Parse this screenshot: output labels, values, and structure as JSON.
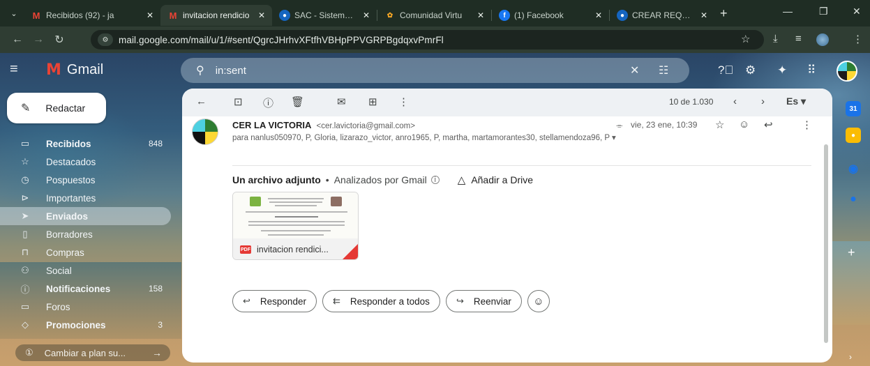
{
  "browser": {
    "tabs": [
      {
        "label": "Recibidos (92) - ja",
        "favicon": "gmail-icon",
        "active": false
      },
      {
        "label": "invitacion rendicio",
        "favicon": "gmail-icon",
        "active": true
      },
      {
        "label": "SAC - Sistema de",
        "favicon": "sac-icon",
        "active": false
      },
      {
        "label": "Comunidad Virtu",
        "favicon": "community-icon",
        "active": false
      },
      {
        "label": "(1) Facebook",
        "favicon": "facebook-icon",
        "active": false
      },
      {
        "label": "CREAR REQUERIN",
        "favicon": "sac-icon",
        "active": false
      }
    ],
    "tab_close": "✕",
    "new_tab": "+",
    "url": "mail.google.com/mail/u/1/#sent/QgrcJHrhvXFtfhVBHpPPVGRPBgdqxvPmrFl"
  },
  "gmail": {
    "logo_text": "Gmail",
    "search_query": "in:sent",
    "compose_label": "Redactar",
    "nav": [
      {
        "label": "Recibidos",
        "count": "848",
        "icon": "inbox-icon",
        "bold": true,
        "active": false
      },
      {
        "label": "Destacados",
        "count": "",
        "icon": "star-icon",
        "bold": false,
        "active": false
      },
      {
        "label": "Pospuestos",
        "count": "",
        "icon": "clock-icon",
        "bold": false,
        "active": false
      },
      {
        "label": "Importantes",
        "count": "",
        "icon": "important-icon",
        "bold": false,
        "active": false
      },
      {
        "label": "Enviados",
        "count": "",
        "icon": "send-icon",
        "bold": true,
        "active": true
      },
      {
        "label": "Borradores",
        "count": "",
        "icon": "draft-icon",
        "bold": false,
        "active": false
      },
      {
        "label": "Compras",
        "count": "",
        "icon": "shopping-icon",
        "bold": false,
        "active": false
      },
      {
        "label": "Social",
        "count": "",
        "icon": "people-icon",
        "bold": false,
        "active": false
      },
      {
        "label": "Notificaciones",
        "count": "158",
        "icon": "info-icon",
        "bold": true,
        "active": false
      },
      {
        "label": "Foros",
        "count": "",
        "icon": "forum-icon",
        "bold": false,
        "active": false
      },
      {
        "label": "Promociones",
        "count": "3",
        "icon": "tag-icon",
        "bold": true,
        "active": false
      }
    ],
    "upgrade_label": "Cambiar a plan su..."
  },
  "message": {
    "pager": "10 de 1.030",
    "language": "Es",
    "sender_name": "CER LA VICTORIA",
    "sender_email": "<cer.lavictoria@gmail.com>",
    "date": "vie, 23 ene, 10:39",
    "recipients": "para nanlus050970, P, Gloria, lizarazo_victor, anro1965, P, martha, martamorantes30, stellamendoza96, P",
    "attachment_title": "Un archivo adjunto",
    "attachment_dot": "•",
    "attachment_scanned": "Analizados por Gmail",
    "add_to_drive": "Añadir a Drive",
    "attachment_name": "invitacion rendici...",
    "pdf_badge": "PDF",
    "reply_label": "Responder",
    "reply_all_label": "Responder a todos",
    "forward_label": "Reenviar"
  },
  "colors": {
    "gmail_red": "#ea4335",
    "pdf_red": "#e53935",
    "active_nav": "rgba(220,230,240,0.45)"
  }
}
